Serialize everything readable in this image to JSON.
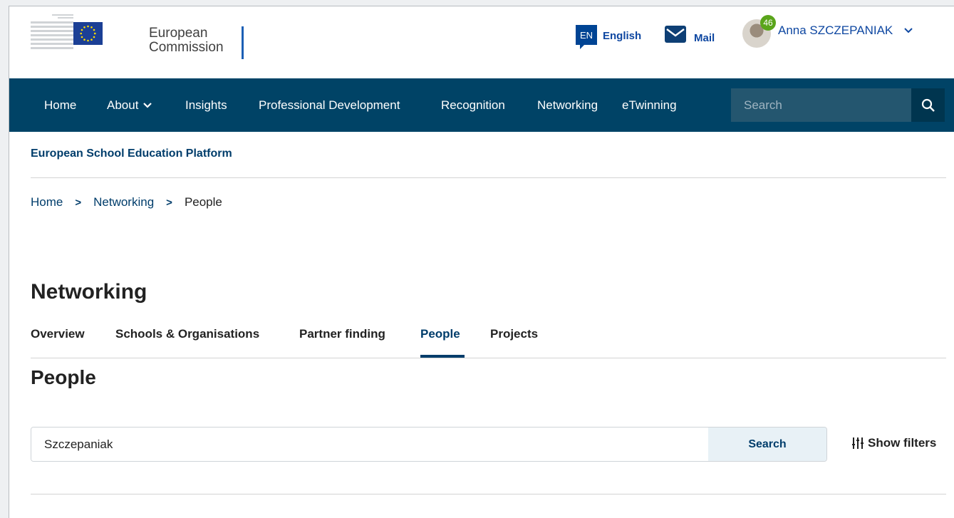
{
  "header": {
    "logo_line1": "European",
    "logo_line2": "Commission",
    "language_code": "EN",
    "language_label": "English",
    "mail_label": "Mail",
    "notification_count": "46",
    "user_name": "Anna SZCZEPANIAK"
  },
  "nav": {
    "items": [
      "Home",
      "About",
      "Insights",
      "Professional Development",
      "Recognition",
      "Networking",
      "eTwinning"
    ],
    "search_placeholder": "Search"
  },
  "platform_title": "European School Education Platform",
  "breadcrumb": [
    "Home",
    "Networking",
    "People"
  ],
  "page_title": "Networking",
  "tabs": [
    "Overview",
    "Schools & Organisations",
    "Partner finding",
    "People",
    "Projects"
  ],
  "active_tab": "People",
  "section_title": "People",
  "people_search": {
    "value": "Szczepaniak",
    "button_label": "Search"
  },
  "show_filters_label": "Show filters",
  "colors": {
    "nav_background": "#004366",
    "accent": "#003d6b",
    "badge": "#5aa51b"
  }
}
